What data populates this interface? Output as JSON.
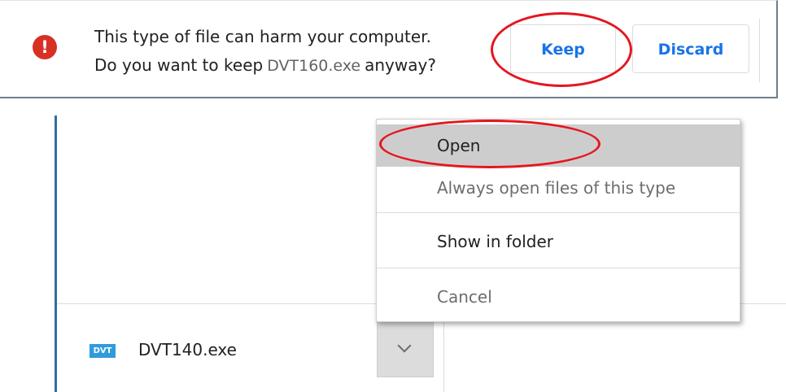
{
  "warning_bar": {
    "line1": "This type of file can harm your computer.",
    "line2_prefix": "Do you want to keep",
    "file_name": "DVT160.exe",
    "line2_suffix": "anyway?",
    "warning_icon": "exclamation-icon",
    "keep_label": "Keep",
    "discard_label": "Discard"
  },
  "context_menu": {
    "items": [
      {
        "label": "Open",
        "state": "highlighted"
      },
      {
        "label": "Always open files of this type",
        "state": "disabled"
      },
      {
        "label": "Show in folder",
        "state": "normal"
      },
      {
        "label": "Cancel",
        "state": "disabled"
      }
    ]
  },
  "download_shelf": {
    "file_icon_label": "DVT",
    "file_name": "DVT140.exe",
    "menu_icon": "chevron-down-icon"
  },
  "colors": {
    "accent": "#1a73e8",
    "warning": "#d93025",
    "annotation": "#e4161f",
    "file_icon": "#2e9cdb"
  }
}
